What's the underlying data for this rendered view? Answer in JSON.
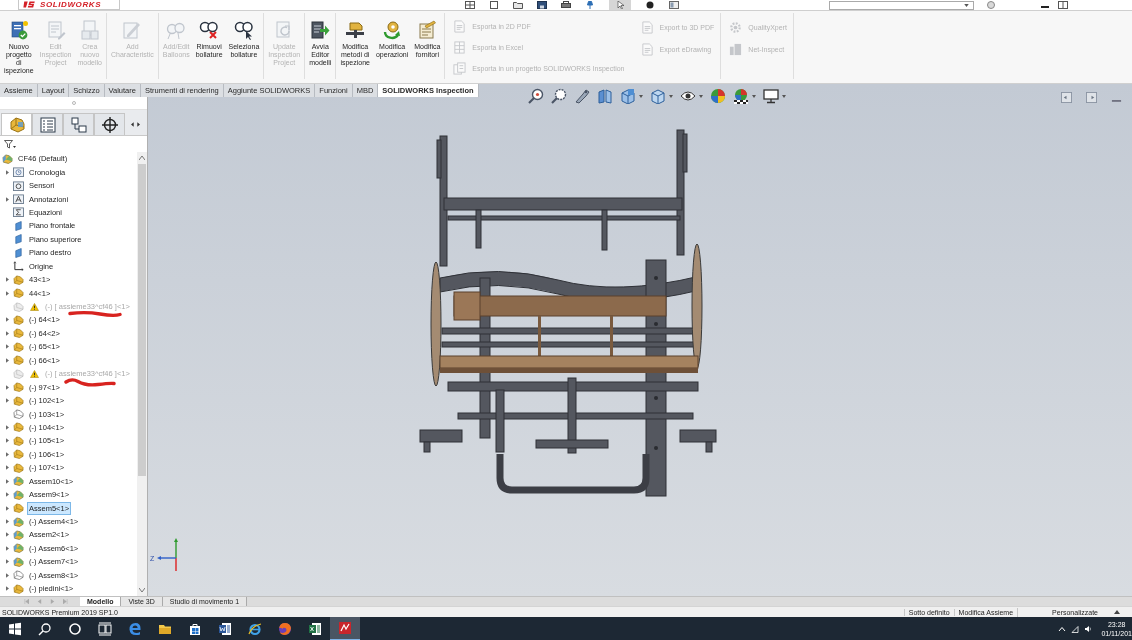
{
  "title_bar": {
    "logo": "SOLIDWORKS"
  },
  "ribbon": {
    "groups": [
      [
        {
          "label": "Nuovo\nprogetto\ndi\nispezione",
          "disabled": false
        },
        {
          "label": "Edit\nInspection\nProject",
          "disabled": true
        },
        {
          "label": "Crea\nnuovo\nmodello",
          "disabled": true
        }
      ],
      [
        {
          "label": "Add\nCharacteristic",
          "disabled": true
        }
      ],
      [
        {
          "label": "Add/Edit\nBalloons",
          "disabled": true
        },
        {
          "label": "Rimuovi\nbollature",
          "disabled": false
        },
        {
          "label": "Seleziona\nbollature",
          "disabled": false
        }
      ],
      [
        {
          "label": "Update\nInspection\nProject",
          "disabled": true
        }
      ],
      [
        {
          "label": "Avvia\nEditor\nmodelli",
          "disabled": false
        }
      ],
      [
        {
          "label": "Modifica\nmetodi di\nispezione",
          "disabled": false
        },
        {
          "label": "Modifica\noperazioni",
          "disabled": false
        },
        {
          "label": "Modifica\nfornitori",
          "disabled": false
        }
      ]
    ],
    "small_groups": [
      [
        [
          {
            "label": "Esporta in 2D PDF",
            "disabled": true
          },
          {
            "label": "Esporta in Excel",
            "disabled": true
          },
          {
            "label": "Esporta in un progetto SOLIDWORKS Inspection",
            "disabled": true
          }
        ],
        [
          {
            "label": "Export to 3D PDF",
            "disabled": true
          },
          {
            "label": "Export eDrawing",
            "disabled": true
          }
        ]
      ],
      [
        [
          {
            "label": "QualityXpert",
            "disabled": true
          },
          {
            "label": "Net-Inspect",
            "disabled": true
          }
        ]
      ]
    ]
  },
  "command_tabs": [
    {
      "label": "Assieme",
      "selected": false
    },
    {
      "label": "Layout",
      "selected": false
    },
    {
      "label": "Schizzo",
      "selected": false
    },
    {
      "label": "Valutare",
      "selected": false
    },
    {
      "label": "Strumenti di rendering",
      "selected": false
    },
    {
      "label": "Aggiunte SOLIDWORKS",
      "selected": false
    },
    {
      "label": "Funzioni",
      "selected": false
    },
    {
      "label": "MBD",
      "selected": false
    },
    {
      "label": "SOLIDWORKS Inspection",
      "selected": true
    }
  ],
  "feature_manager": {
    "tabs": [
      {
        "selected": true
      },
      {
        "selected": false
      },
      {
        "selected": false
      },
      {
        "selected": false
      }
    ],
    "tree": {
      "label": "CF46 (Default)",
      "kind": "assembly",
      "expandable": false,
      "selected": false,
      "children": [
        {
          "label": "Cronologia",
          "kind": "history",
          "expandable": true,
          "selected": false
        },
        {
          "label": "Sensori",
          "kind": "sensors",
          "expandable": false,
          "selected": false
        },
        {
          "label": "Annotazioni",
          "kind": "annotations",
          "expandable": true,
          "selected": false
        },
        {
          "label": "Equazioni",
          "kind": "equations",
          "expandable": false,
          "selected": false
        },
        {
          "label": "Piano frontale",
          "kind": "plane",
          "expandable": false,
          "selected": false
        },
        {
          "label": "Piano superiore",
          "kind": "plane",
          "expandable": false,
          "selected": false
        },
        {
          "label": "Piano destro",
          "kind": "plane",
          "expandable": false,
          "selected": false
        },
        {
          "label": "Origine",
          "kind": "origin",
          "expandable": false,
          "selected": false
        },
        {
          "label": "43<1>",
          "kind": "component",
          "expandable": true,
          "selected": false
        },
        {
          "label": "44<1>",
          "kind": "component",
          "expandable": true,
          "selected": false
        },
        {
          "label": "(-) [ assieme33^cf46 ]<1>",
          "kind": "suppressed",
          "expandable": false,
          "selected": false
        },
        {
          "label": "(-) 64<1>",
          "kind": "component",
          "expandable": true,
          "selected": false
        },
        {
          "label": "(-) 64<2>",
          "kind": "component",
          "expandable": true,
          "selected": false
        },
        {
          "label": "(-) 65<1>",
          "kind": "component",
          "expandable": true,
          "selected": false
        },
        {
          "label": "(-) 66<1>",
          "kind": "component",
          "expandable": true,
          "selected": false
        },
        {
          "label": "(-) [ assieme33^cf46 ]<1>",
          "kind": "suppressed",
          "expandable": false,
          "selected": false
        },
        {
          "label": "(-) 97<1>",
          "kind": "component",
          "expandable": true,
          "selected": false
        },
        {
          "label": "(-) 102<1>",
          "kind": "component",
          "expandable": true,
          "selected": false
        },
        {
          "label": "(-) 103<1>",
          "kind": "outline",
          "expandable": false,
          "selected": false
        },
        {
          "label": "(-) 104<1>",
          "kind": "component",
          "expandable": true,
          "selected": false
        },
        {
          "label": "(-) 105<1>",
          "kind": "component",
          "expandable": true,
          "selected": false
        },
        {
          "label": "(-) 106<1>",
          "kind": "component",
          "expandable": true,
          "selected": false
        },
        {
          "label": "(-) 107<1>",
          "kind": "component",
          "expandable": true,
          "selected": false
        },
        {
          "label": "Assem10<1>",
          "kind": "assembly",
          "expandable": true,
          "selected": false
        },
        {
          "label": "Assem9<1>",
          "kind": "assembly",
          "expandable": true,
          "selected": false
        },
        {
          "label": "Assem5<1>",
          "kind": "component",
          "expandable": true,
          "selected": true
        },
        {
          "label": "(-) Assem4<1>",
          "kind": "assembly",
          "expandable": true,
          "selected": false
        },
        {
          "label": "Assem2<1>",
          "kind": "assembly",
          "expandable": true,
          "selected": false
        },
        {
          "label": "(-) Assem6<1>",
          "kind": "assembly",
          "expandable": true,
          "selected": false
        },
        {
          "label": "(-) Assem7<1>",
          "kind": "assembly",
          "expandable": true,
          "selected": false
        },
        {
          "label": "(-) Assem8<1>",
          "kind": "outline",
          "expandable": true,
          "selected": false
        },
        {
          "label": "(-) piedini<1>",
          "kind": "component",
          "expandable": true,
          "selected": false
        }
      ]
    }
  },
  "model_view": {
    "triad_label": "Z"
  },
  "bottom_tabs": [
    {
      "label": "Modello",
      "selected": true
    },
    {
      "label": "Viste 3D",
      "selected": false
    },
    {
      "label": "Studio di movimento 1",
      "selected": false
    }
  ],
  "status_bar": {
    "product": "SOLIDWORKS Premium 2019 SP1.0",
    "status": "Sotto definito",
    "mode": "Modifica Assieme",
    "units": "Personalizzate"
  },
  "taskbar": {
    "apps": [
      {
        "active": false
      },
      {
        "active": false
      },
      {
        "active": false
      },
      {
        "active": false
      },
      {
        "active": false
      },
      {
        "active": false
      },
      {
        "active": false
      },
      {
        "active": true
      }
    ],
    "time": "23:28",
    "date": "01/11/201"
  }
}
